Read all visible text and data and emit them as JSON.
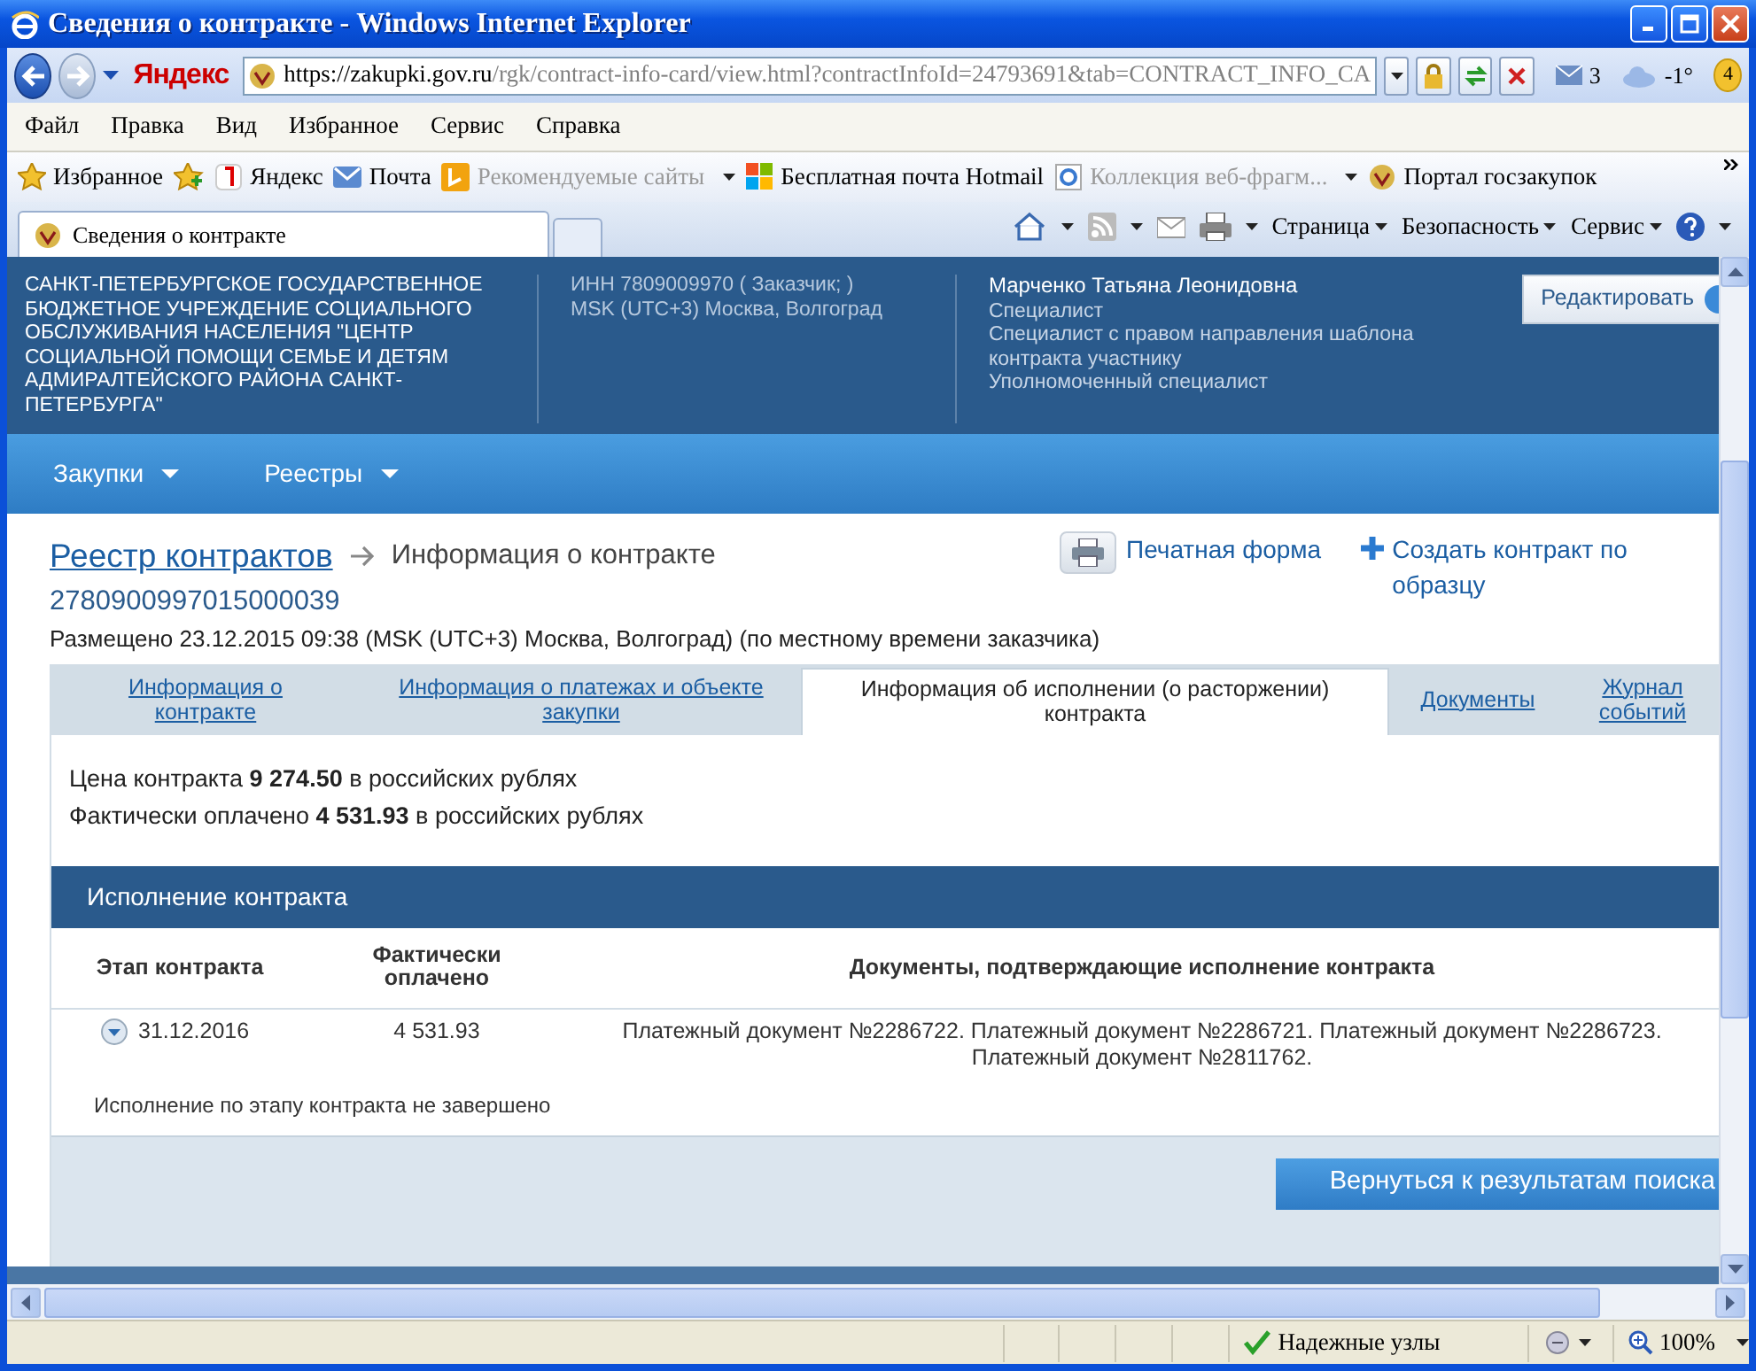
{
  "window": {
    "title": "Сведения о контракте - Windows Internet Explorer"
  },
  "address_bar": {
    "brand": "Яндекс",
    "url_host": "https://zakupki.gov.ru",
    "url_path": "/rgk/contract-info-card/view.html?contractInfoId=24793691&tab=CONTRACT_INFO_CA",
    "mail_count": "3",
    "temperature": "-1°",
    "badge": "4"
  },
  "menu": [
    "Файл",
    "Правка",
    "Вид",
    "Избранное",
    "Сервис",
    "Справка"
  ],
  "favorites_bar": {
    "title": "Избранное",
    "items": [
      {
        "label": "Яндекс",
        "disabled": false,
        "dropdown": false
      },
      {
        "label": "Почта",
        "disabled": false,
        "dropdown": false
      },
      {
        "label": "Рекомендуемые сайты",
        "disabled": true,
        "dropdown": true
      },
      {
        "label": "Бесплатная почта Hotmail",
        "disabled": false,
        "dropdown": false
      },
      {
        "label": "Коллекция веб-фрагм...",
        "disabled": true,
        "dropdown": true
      },
      {
        "label": "Портал госзакупок",
        "disabled": false,
        "dropdown": false
      }
    ]
  },
  "browser_tab": {
    "label": "Сведения о контракте",
    "selected": true
  },
  "command_bar": [
    "Страница",
    "Безопасность",
    "Сервис"
  ],
  "site_header": {
    "organization": "САНКТ-ПЕТЕРБУРГСКОЕ ГОСУДАРСТВЕННОЕ БЮДЖЕТНОЕ УЧРЕЖДЕНИЕ СОЦИАЛЬНОГО ОБСЛУЖИВАНИЯ НАСЕЛЕНИЯ \"ЦЕНТР СОЦИАЛЬНОЙ ПОМОЩИ СЕМЬЕ И ДЕТЯМ АДМИРАЛТЕЙСКОГО РАЙОНА САНКТ-ПЕТЕРБУРГА\"",
    "inn": "ИНН 7809009970 ( Заказчик; )",
    "timezone": "MSK (UTC+3) Москва, Волгоград",
    "user_name": "Марченко Татьяна Леонидовна",
    "roles": [
      "Специалист",
      "Специалист с правом направления шаблона контракта участнику",
      "Уполномоченный специалист"
    ],
    "edit_button": "Редактировать"
  },
  "nav": [
    "Закупки",
    "Реестры"
  ],
  "breadcrumb": {
    "link": "Реестр контрактов",
    "current": "Информация о контракте",
    "number": "2780900997015000039"
  },
  "actions": {
    "print": "Печатная форма",
    "create": "Создать контракт по образцу"
  },
  "published": "Размещено 23.12.2015 09:38 (MSK (UTC+3) Москва, Волгоград) (по местному времени заказчика)",
  "tabs": [
    {
      "label": "Информация о контракте",
      "selected": false
    },
    {
      "label": "Информация о платежах и объекте закупки",
      "selected": false
    },
    {
      "label": "Информация об исполнении (о расторжении) контракта",
      "selected": true
    },
    {
      "label": "Документы",
      "selected": false
    },
    {
      "label": "Журнал событий",
      "selected": false
    }
  ],
  "summary": [
    "Цена контракта **9 274.50** в российских рублях",
    "Фактически оплачено **4 531.93** в российских рублях"
  ],
  "execution": {
    "title": "Исполнение контракта",
    "columns": [
      "Этап контракта",
      "Фактически оплачено",
      "Документы, подтверждающие исполнение контракта"
    ],
    "rows": [
      {
        "stage": "31.12.2016",
        "paid": "4 531.93",
        "documents": "Платежный документ №2286722. Платежный документ №2286721. Платежный документ №2286723. Платежный документ №2811762.",
        "status": "Исполнение по этапу контракта не завершено"
      }
    ]
  },
  "back_button": "Вернуться к результатам поиска",
  "status_bar": {
    "zone": "Надежные узлы",
    "zoom": "100%"
  }
}
